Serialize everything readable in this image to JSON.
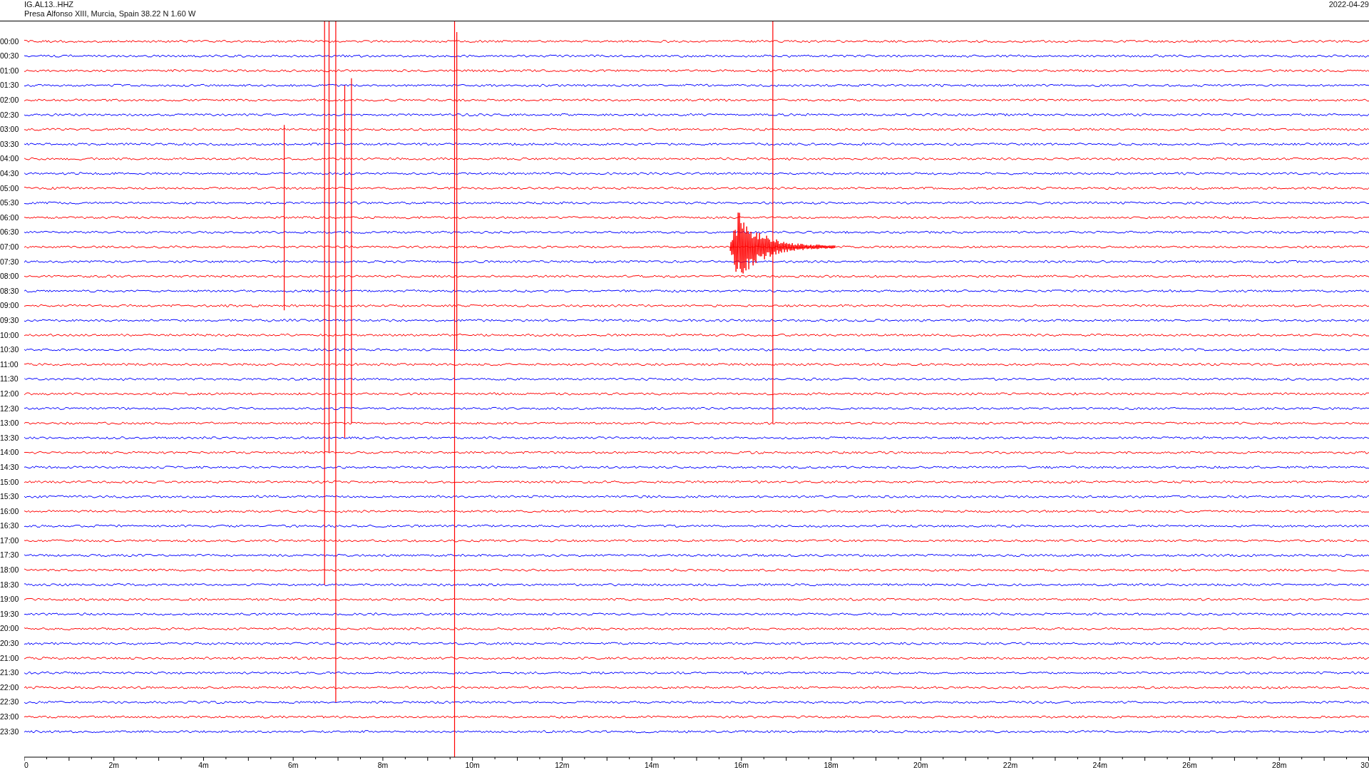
{
  "header": {
    "station": "IG.AL13..HHZ",
    "location": "Presa Alfonso XIII, Murcia, Spain  38.22 N 1.60 W",
    "date": "2022-04-29"
  },
  "rows": [
    {
      "time": "00:00",
      "color": "#ff0000"
    },
    {
      "time": "00:30",
      "color": "#0000ff"
    },
    {
      "time": "01:00",
      "color": "#ff0000"
    },
    {
      "time": "01:30",
      "color": "#0000ff"
    },
    {
      "time": "02:00",
      "color": "#ff0000"
    },
    {
      "time": "02:30",
      "color": "#0000ff"
    },
    {
      "time": "03:00",
      "color": "#ff0000"
    },
    {
      "time": "03:30",
      "color": "#0000ff"
    },
    {
      "time": "04:00",
      "color": "#ff0000"
    },
    {
      "time": "04:30",
      "color": "#0000ff"
    },
    {
      "time": "05:00",
      "color": "#ff0000"
    },
    {
      "time": "05:30",
      "color": "#0000ff"
    },
    {
      "time": "06:00",
      "color": "#ff0000"
    },
    {
      "time": "06:30",
      "color": "#0000ff"
    },
    {
      "time": "07:00",
      "color": "#ff0000"
    },
    {
      "time": "07:30",
      "color": "#0000ff"
    },
    {
      "time": "08:00",
      "color": "#ff0000"
    },
    {
      "time": "08:30",
      "color": "#0000ff"
    },
    {
      "time": "09:00",
      "color": "#ff0000"
    },
    {
      "time": "09:30",
      "color": "#0000ff"
    },
    {
      "time": "10:00",
      "color": "#ff0000"
    },
    {
      "time": "10:30",
      "color": "#0000ff"
    },
    {
      "time": "11:00",
      "color": "#ff0000"
    },
    {
      "time": "11:30",
      "color": "#0000ff"
    },
    {
      "time": "12:00",
      "color": "#ff0000"
    },
    {
      "time": "12:30",
      "color": "#0000ff"
    },
    {
      "time": "13:00",
      "color": "#ff0000"
    },
    {
      "time": "13:30",
      "color": "#0000ff"
    },
    {
      "time": "14:00",
      "color": "#ff0000"
    },
    {
      "time": "14:30",
      "color": "#0000ff"
    },
    {
      "time": "15:00",
      "color": "#ff0000"
    },
    {
      "time": "15:30",
      "color": "#0000ff"
    },
    {
      "time": "16:00",
      "color": "#ff0000"
    },
    {
      "time": "16:30",
      "color": "#0000ff"
    },
    {
      "time": "17:00",
      "color": "#ff0000"
    },
    {
      "time": "17:30",
      "color": "#0000ff"
    },
    {
      "time": "18:00",
      "color": "#ff0000"
    },
    {
      "time": "18:30",
      "color": "#0000ff"
    },
    {
      "time": "19:00",
      "color": "#ff0000"
    },
    {
      "time": "19:30",
      "color": "#0000ff"
    },
    {
      "time": "20:00",
      "color": "#ff0000"
    },
    {
      "time": "20:30",
      "color": "#0000ff"
    },
    {
      "time": "21:00",
      "color": "#ff0000"
    },
    {
      "time": "21:30",
      "color": "#0000ff"
    },
    {
      "time": "22:00",
      "color": "#ff0000"
    },
    {
      "time": "22:30",
      "color": "#0000ff"
    },
    {
      "time": "23:00",
      "color": "#ff0000"
    },
    {
      "time": "23:30",
      "color": "#0000ff"
    }
  ],
  "x_axis": {
    "labels": [
      "0",
      "2m",
      "4m",
      "6m",
      "8m",
      "10m",
      "12m",
      "14m",
      "16m",
      "18m",
      "20m",
      "22m",
      "24m",
      "26m",
      "28m",
      "30"
    ]
  }
}
